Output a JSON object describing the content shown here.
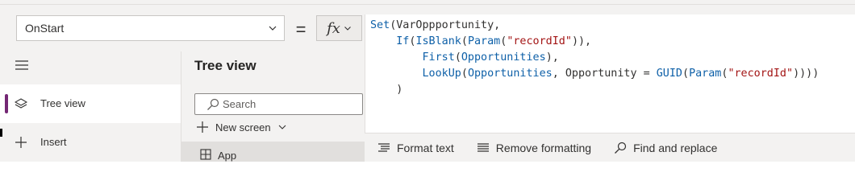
{
  "formula_bar": {
    "property_value": "OnStart",
    "equals": "=",
    "fx_label": "fx",
    "code_lines": [
      [
        {
          "t": "fn",
          "v": "Set"
        },
        {
          "t": "p",
          "v": "(VarOppportunity,"
        }
      ],
      [
        {
          "t": "p",
          "v": "    "
        },
        {
          "t": "fn",
          "v": "If"
        },
        {
          "t": "p",
          "v": "("
        },
        {
          "t": "fn",
          "v": "IsBlank"
        },
        {
          "t": "p",
          "v": "("
        },
        {
          "t": "fn",
          "v": "Param"
        },
        {
          "t": "p",
          "v": "("
        },
        {
          "t": "str",
          "v": "\"recordId\""
        },
        {
          "t": "p",
          "v": ")),"
        }
      ],
      [
        {
          "t": "p",
          "v": "        "
        },
        {
          "t": "fn",
          "v": "First"
        },
        {
          "t": "p",
          "v": "("
        },
        {
          "t": "tbl",
          "v": "Opportunities"
        },
        {
          "t": "p",
          "v": "),"
        }
      ],
      [
        {
          "t": "p",
          "v": "        "
        },
        {
          "t": "fn",
          "v": "LookUp"
        },
        {
          "t": "p",
          "v": "("
        },
        {
          "t": "tbl",
          "v": "Opportunities"
        },
        {
          "t": "p",
          "v": ", Opportunity = "
        },
        {
          "t": "fn",
          "v": "GUID"
        },
        {
          "t": "p",
          "v": "("
        },
        {
          "t": "fn",
          "v": "Param"
        },
        {
          "t": "p",
          "v": "("
        },
        {
          "t": "str",
          "v": "\"recordId\""
        },
        {
          "t": "p",
          "v": "))))"
        }
      ],
      [
        {
          "t": "p",
          "v": "    )"
        }
      ]
    ]
  },
  "code_toolbar": {
    "format_text": "Format text",
    "remove_formatting": "Remove formatting",
    "find_replace": "Find and replace"
  },
  "left_rail": {
    "items": [
      {
        "label": "Tree view",
        "icon": "layers-icon",
        "active": true
      },
      {
        "label": "Insert",
        "icon": "plus-icon",
        "active": false
      }
    ]
  },
  "tree_panel": {
    "title": "Tree view",
    "search_placeholder": "Search",
    "new_screen": "New screen",
    "app_item": "App"
  },
  "colors": {
    "accent": "#742774",
    "function": "#0e60a8",
    "string": "#a31515"
  }
}
